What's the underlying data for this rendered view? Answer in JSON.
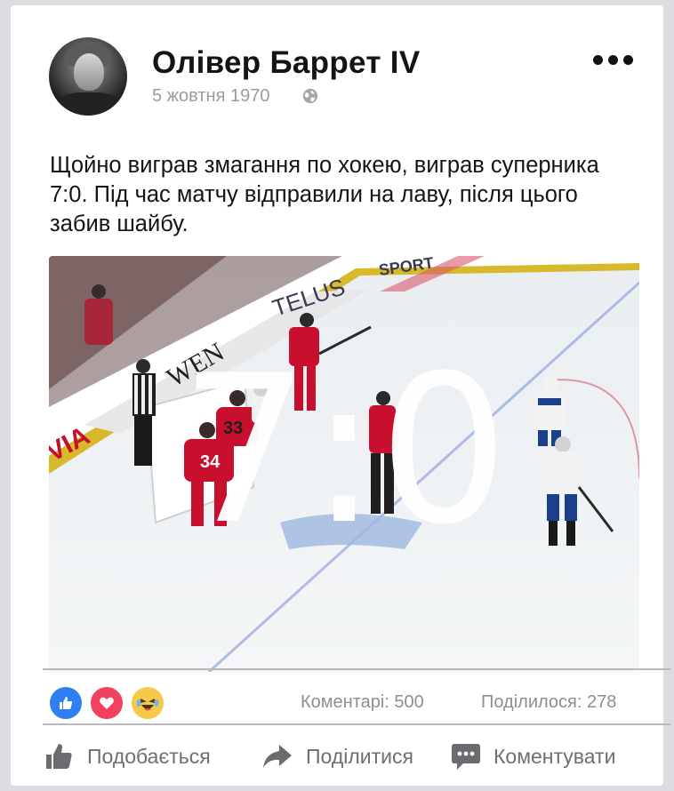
{
  "post": {
    "author": "Олівер Баррет IV",
    "date": "5 жовтня 1970",
    "text": "Щойно виграв змагання по хокею, виграв суперника 7:0. Під час матчу відправили на лаву, після цього забив шайбу.",
    "image_overlay": "7:0",
    "visibility_icon": "globe-icon",
    "menu_icon": "more-horizontal-icon"
  },
  "image": {
    "description_label": "hockey-game",
    "board_texts": [
      "TELUS",
      "SPORT",
      "VIA",
      "WEN"
    ],
    "jersey_numbers": [
      "33",
      "34"
    ]
  },
  "reactions": {
    "icons": [
      "like-icon",
      "love-icon",
      "haha-icon"
    ],
    "comments": "Коментарі: 500",
    "shares": "Поділилося: 278"
  },
  "actions": {
    "like": "Подобається",
    "share": "Поділитися",
    "comment": "Коментувати"
  },
  "colors": {
    "like_blue": "#2f7ef2",
    "love_red": "#f3425f",
    "haha_yellow": "#f7c948",
    "flames_red": "#c8102e",
    "blues_white": "#f2f2f2"
  }
}
